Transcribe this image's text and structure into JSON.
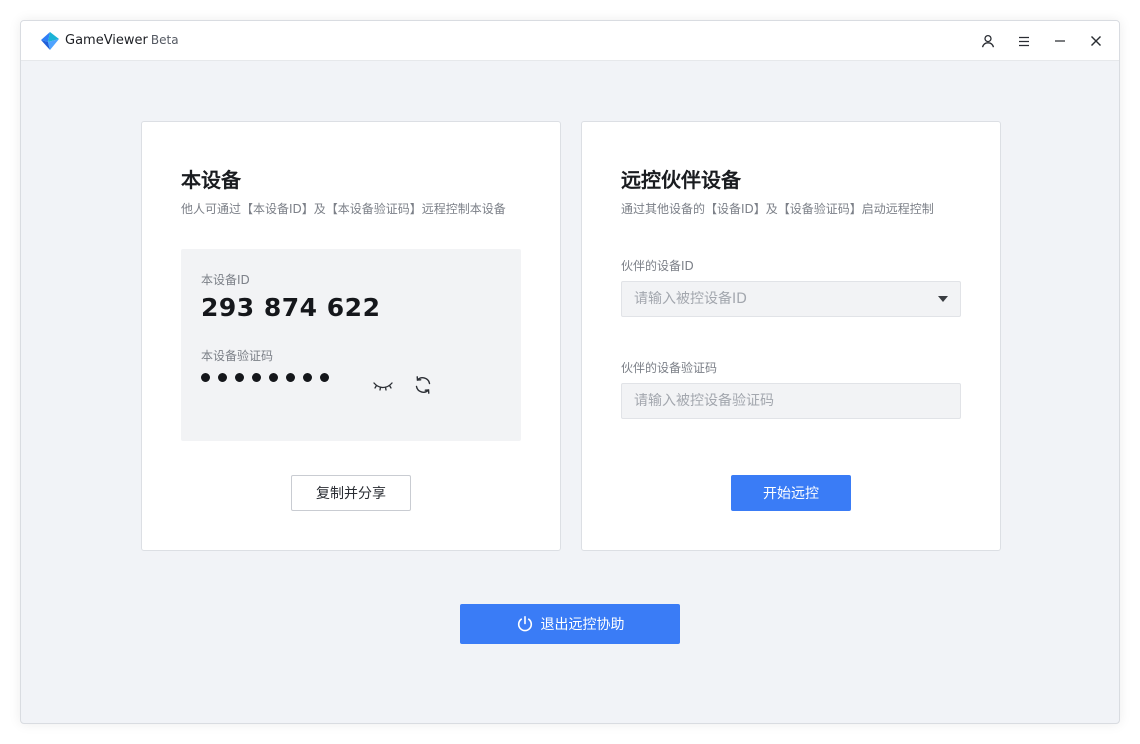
{
  "app": {
    "name": "GameViewer",
    "badge": "Beta"
  },
  "titlebar": {
    "icons": [
      "user-icon",
      "menu-icon",
      "minimize-icon",
      "close-icon"
    ]
  },
  "local": {
    "title": "本设备",
    "subtitle": "他人可通过【本设备ID】及【本设备验证码】远程控制本设备",
    "id_label": "本设备ID",
    "id_value": "293 874 622",
    "code_label": "本设备验证码",
    "code_mask": "••••••••",
    "share_button": "复制并分享"
  },
  "remote": {
    "title": "远控伙伴设备",
    "subtitle": "通过其他设备的【设备ID】及【设备验证码】启动远程控制",
    "id_label": "伙伴的设备ID",
    "id_placeholder": "请输入被控设备ID",
    "code_label": "伙伴的设备验证码",
    "code_placeholder": "请输入被控设备验证码",
    "start_button": "开始远控"
  },
  "exit_button": "退出远控协助",
  "colors": {
    "accent": "#3a7cf6",
    "background": "#f1f3f7",
    "logo_blue": "#2f7df6",
    "logo_teal": "#1bb3d6"
  }
}
